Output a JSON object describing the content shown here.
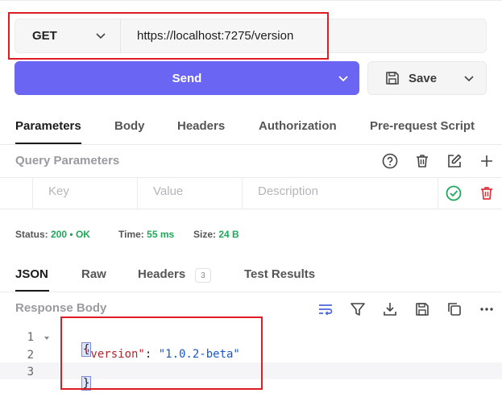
{
  "request": {
    "method": "GET",
    "url": "https://localhost:7275/version",
    "send_label": "Send",
    "save_label": "Save"
  },
  "request_tabs": [
    "Parameters",
    "Body",
    "Headers",
    "Authorization",
    "Pre-request Script"
  ],
  "query_params": {
    "title": "Query Parameters",
    "key_placeholder": "Key",
    "value_placeholder": "Value",
    "description_placeholder": "Description"
  },
  "status": {
    "status_label": "Status:",
    "status_code": "200",
    "status_text": "OK",
    "time_label": "Time:",
    "time_value": "55 ms",
    "size_label": "Size:",
    "size_value": "24 B"
  },
  "response_tabs": {
    "json": "JSON",
    "raw": "Raw",
    "headers": "Headers",
    "headers_count": "3",
    "test_results": "Test Results"
  },
  "response_body": {
    "title": "Response Body",
    "line_numbers": [
      "1",
      "2",
      "3"
    ],
    "open_brace": "{",
    "close_brace": "}",
    "key": "\"version\"",
    "colon": ": ",
    "value": "\"1.0.2-beta\""
  },
  "colors": {
    "accent": "#6a65f2",
    "success": "#1fa85a",
    "danger": "#e0353b",
    "highlight_box": "#dd1c24"
  }
}
